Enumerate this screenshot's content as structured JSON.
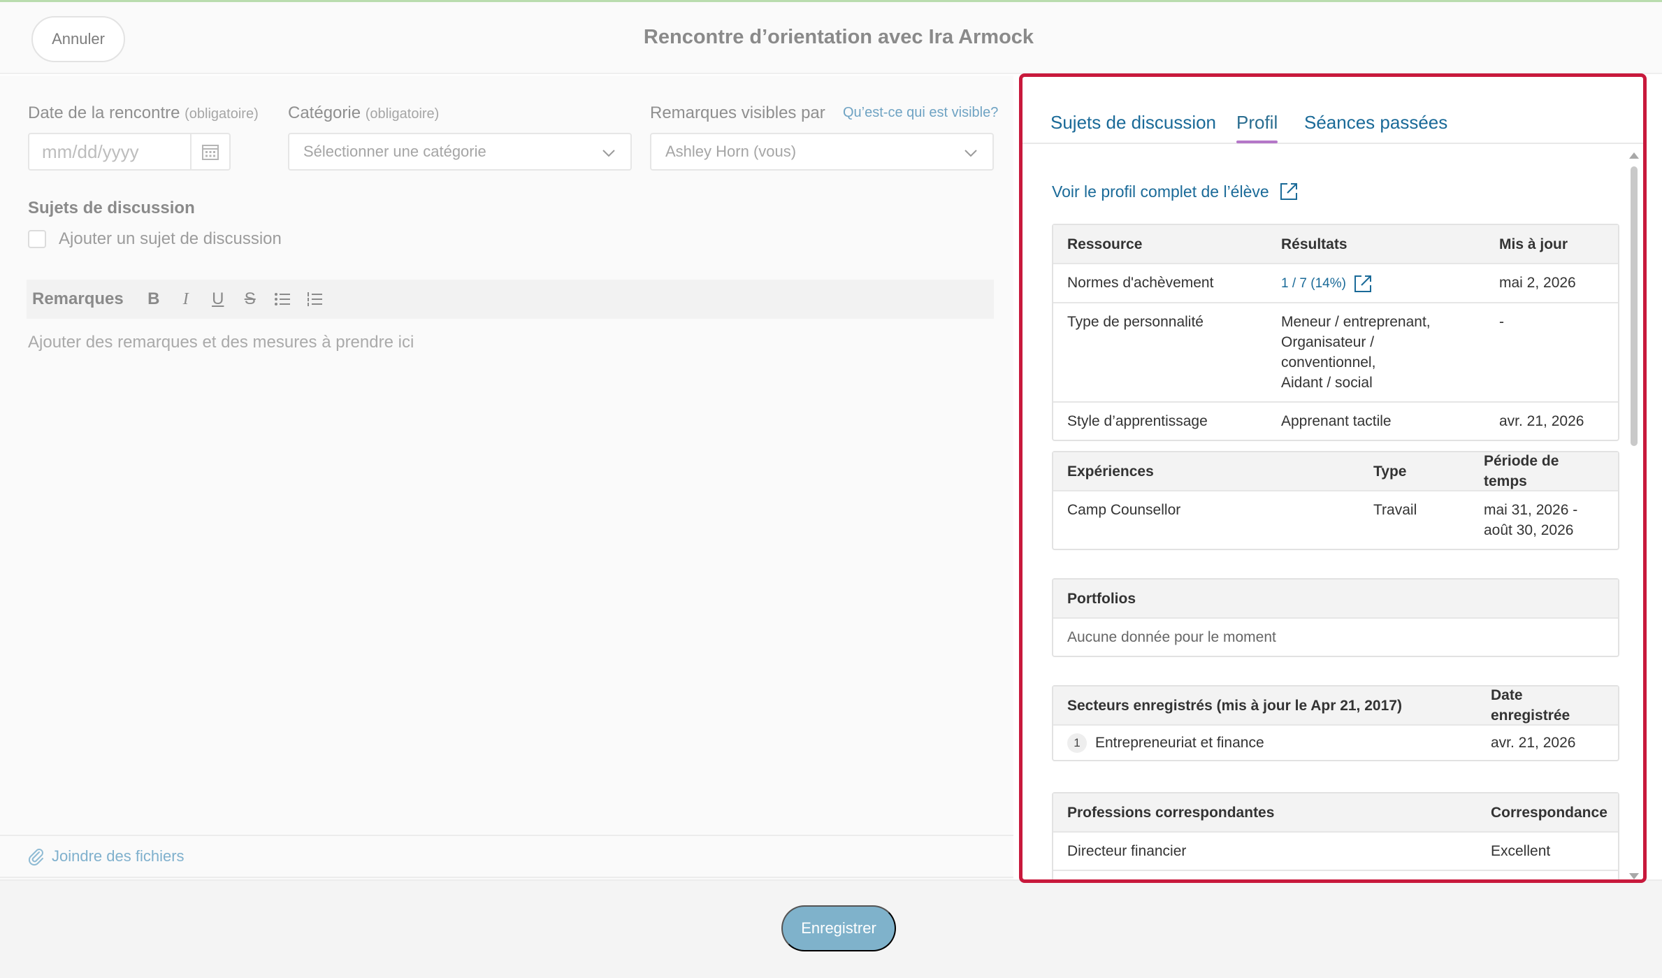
{
  "header": {
    "cancel_label": "Annuler",
    "title": "Rencontre d’orientation avec Ira Armock"
  },
  "form": {
    "date_label": "Date de la rencontre",
    "date_required": "(obligatoire)",
    "date_placeholder": "mm/dd/yyyy",
    "category_label": "Catégorie",
    "category_required": "(obligatoire)",
    "category_placeholder": "Sélectionner une catégorie",
    "visibility_label": "Remarques visibles par",
    "visibility_help": "Qu’est-ce qui est visible?",
    "visibility_value": "Ashley Horn (vous)",
    "topics_title": "Sujets de discussion",
    "add_topic_label": "Ajouter un sujet de discussion",
    "notes_label": "Remarques",
    "toolbar": [
      "B",
      "I",
      "U",
      "S"
    ],
    "notes_placeholder": "Ajouter des remarques et des mesures à prendre ici",
    "attach_label": "Joindre des fichiers",
    "save_label": "Enregistrer"
  },
  "panel": {
    "tabs": [
      "Sujets de discussion",
      "Profil",
      "Séances passées"
    ],
    "active_tab": "Profil",
    "profile_link": "Voir le profil complet de l’élève",
    "resources": {
      "headers": [
        "Ressource",
        "Résultats",
        "Mis à jour"
      ],
      "rows": [
        {
          "name": "Normes d'achèvement",
          "result": "1 / 7 (14%)",
          "updated": "mai 2, 2026"
        },
        {
          "name": "Type de personnalité",
          "result_lines": [
            "Meneur / entreprenant,",
            "Organisateur / conventionnel,",
            "Aidant / social"
          ],
          "updated": "-"
        },
        {
          "name": "Style d’apprentissage",
          "result": "Apprenant tactile",
          "updated": "avr. 21, 2026"
        }
      ]
    },
    "experiences": {
      "headers": [
        "Expériences",
        "Type",
        "Période de temps"
      ],
      "rows": [
        {
          "name": "Camp Counsellor",
          "type": "Travail",
          "period_lines": [
            "mai 31, 2026 -",
            "août 30, 2026"
          ]
        }
      ]
    },
    "portfolios": {
      "header": "Portfolios",
      "empty": "Aucune donnée pour le moment"
    },
    "sectors": {
      "headers": [
        "Secteurs enregistrés (mis à jour le Apr 21, 2017)",
        "Date enregistrée"
      ],
      "rows": [
        {
          "rank": "1",
          "name": "Entrepreneuriat et finance",
          "date": "avr. 21, 2026"
        }
      ]
    },
    "professions": {
      "headers": [
        "Professions correspondantes",
        "Correspondance"
      ],
      "rows": [
        {
          "name": "Directeur financier",
          "match": "Excellent"
        }
      ]
    }
  },
  "colors": {
    "highlight_border": "#c8193c",
    "link": "#1a6a98",
    "active_tab_underline": "#b477c8",
    "save_button": "#7fb2cb"
  }
}
